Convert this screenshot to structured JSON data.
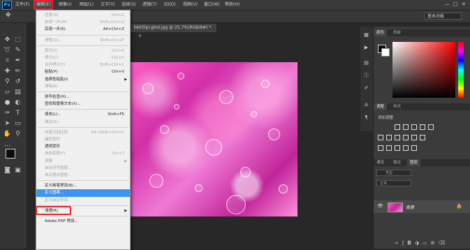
{
  "menubar": {
    "logo": "Ps",
    "items": [
      "文件(F)",
      "编辑(E)",
      "图像(I)",
      "图层(L)",
      "文字(Y)",
      "选择(S)",
      "滤镜(T)",
      "3D(D)",
      "视图(V)",
      "窗口(W)",
      "帮助(H)"
    ],
    "active_index": 1,
    "win_controls": [
      "—",
      "□",
      "✕"
    ]
  },
  "optionsbar": {
    "workspace": "基本功能"
  },
  "document": {
    "tab_title": "bbk5lpl.glod.jpg @ 25.7%(RGB/8#) *",
    "tab_close": "×"
  },
  "edit_menu": {
    "items": [
      {
        "label": "还原(O)",
        "shortcut": "Ctrl+Z",
        "state": "disabled"
      },
      {
        "label": "前进一步(W)",
        "shortcut": "Shift+Ctrl+Z",
        "state": "disabled"
      },
      {
        "label": "后退一步(K)",
        "shortcut": "Alt+Ctrl+Z",
        "state": "enabled"
      },
      {
        "sep": true
      },
      {
        "label": "渐隐(D)...",
        "shortcut": "Shift+Ctrl+F",
        "state": "disabled"
      },
      {
        "sep": true
      },
      {
        "label": "剪切(T)",
        "shortcut": "Ctrl+X",
        "state": "disabled"
      },
      {
        "label": "拷贝(C)",
        "shortcut": "Ctrl+C",
        "state": "disabled"
      },
      {
        "label": "合并拷贝(Y)",
        "shortcut": "Shift+Ctrl+C",
        "state": "disabled"
      },
      {
        "label": "粘贴(P)",
        "shortcut": "Ctrl+V",
        "state": "enabled"
      },
      {
        "label": "选择性粘贴(I)",
        "shortcut": "",
        "state": "enabled",
        "submenu": true
      },
      {
        "label": "清除(E)",
        "shortcut": "",
        "state": "disabled"
      },
      {
        "sep": true
      },
      {
        "label": "拼写检查(H)...",
        "shortcut": "",
        "state": "enabled"
      },
      {
        "label": "查找和替换文本(X)...",
        "shortcut": "",
        "state": "enabled"
      },
      {
        "sep": true
      },
      {
        "label": "填充(L)...",
        "shortcut": "Shift+F5",
        "state": "enabled"
      },
      {
        "label": "描边(S)...",
        "shortcut": "",
        "state": "disabled"
      },
      {
        "sep": true
      },
      {
        "label": "内容识别比例",
        "shortcut": "Alt+Shift+Ctrl+C",
        "state": "disabled"
      },
      {
        "label": "操控变形",
        "shortcut": "",
        "state": "disabled"
      },
      {
        "label": "透视变形",
        "shortcut": "",
        "state": "enabled"
      },
      {
        "label": "自由变换(F)",
        "shortcut": "Ctrl+T",
        "state": "disabled"
      },
      {
        "label": "变换",
        "shortcut": "",
        "state": "disabled",
        "submenu": true
      },
      {
        "label": "自动对齐图层...",
        "shortcut": "",
        "state": "disabled"
      },
      {
        "label": "自动混合图层...",
        "shortcut": "",
        "state": "disabled"
      },
      {
        "sep": true
      },
      {
        "label": "定义画笔预设(B)...",
        "shortcut": "",
        "state": "enabled"
      },
      {
        "label": "定义图案...",
        "shortcut": "",
        "state": "highlighted"
      },
      {
        "label": "定义自定形状...",
        "shortcut": "",
        "state": "disabled"
      },
      {
        "sep": true
      },
      {
        "label": "清理(R)",
        "shortcut": "",
        "state": "enabled",
        "submenu": true
      },
      {
        "sep": true
      },
      {
        "label": "Adobe PDF 预设...",
        "shortcut": "",
        "state": "enabled"
      }
    ]
  },
  "panels": {
    "color_tabs": [
      "颜色",
      "色板"
    ],
    "adjust_tabs": [
      "调整",
      "样式"
    ],
    "adjust_title": "添加调整",
    "layers_tabs": [
      "图层",
      "通道",
      "路径"
    ],
    "layers_kind": "类型",
    "layers_blend": "正常",
    "layer_name": "背景"
  },
  "colors": {
    "accent": "#3d95f2",
    "highlight_box": "#e8262c"
  }
}
